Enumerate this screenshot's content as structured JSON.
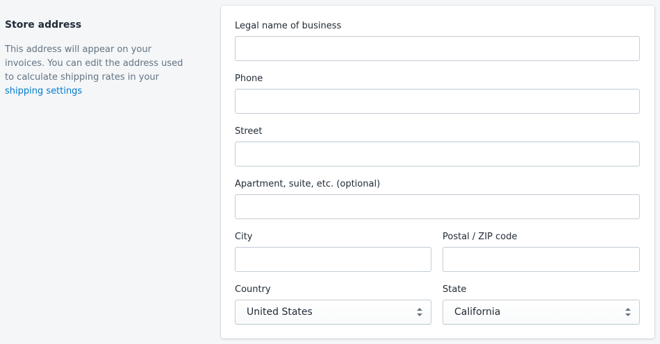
{
  "section": {
    "title": "Store address",
    "description": "This address will appear on your invoices. You can edit the address used to calculate shipping rates in your",
    "link_text": "shipping settings"
  },
  "form": {
    "legal_name": {
      "label": "Legal name of business",
      "value": ""
    },
    "phone": {
      "label": "Phone",
      "value": ""
    },
    "street": {
      "label": "Street",
      "value": ""
    },
    "apartment": {
      "label": "Apartment, suite, etc. (optional)",
      "value": ""
    },
    "city": {
      "label": "City",
      "value": ""
    },
    "postal": {
      "label": "Postal / ZIP code",
      "value": ""
    },
    "country": {
      "label": "Country",
      "value": "United States"
    },
    "state": {
      "label": "State",
      "value": "California"
    }
  },
  "icons": {
    "select_arrows": "chevron-up-down-icon"
  },
  "colors": {
    "page_background": "#f4f6f8",
    "card_background": "#ffffff",
    "text": "#212b36",
    "subdued_text": "#637381",
    "link": "#007ace",
    "input_border": "#c4cdd5"
  }
}
